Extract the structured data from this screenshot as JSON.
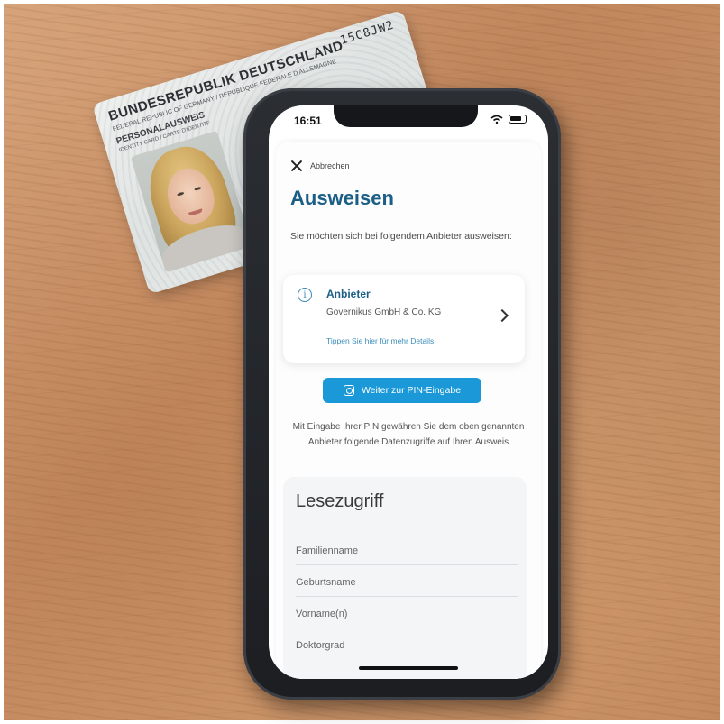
{
  "id_card": {
    "title": "BUNDESREPUBLIK DEUTSCHLAND",
    "subtitle": "FEDERAL REPUBLIC OF GERMANY / REPUBLIQUE FEDERALE D'ALLEMAGNE",
    "doc_type": "PERSONALAUSWEIS",
    "doc_type_sub": "IDENTITY CARD / CARTE D'IDENTITE",
    "number": "15C8JW2"
  },
  "status_bar": {
    "time": "16:51"
  },
  "sheet": {
    "close_label": "Abbrechen",
    "title": "Ausweisen",
    "intro": "Sie möchten sich bei folgendem Anbieter ausweisen:",
    "provider": {
      "label": "Anbieter",
      "name": "Governikus GmbH & Co. KG",
      "details_link": "Tippen Sie hier für mehr Details"
    },
    "pin_button": "Weiter zur PIN-Eingabe",
    "consent": "Mit Eingabe Ihrer PIN gewähren Sie dem oben genannten Anbieter folgende Datenzugriffe auf Ihren Ausweis",
    "read_access": {
      "title": "Lesezugriff",
      "fields": [
        "Familienname",
        "Geburtsname",
        "Vorname(n)",
        "Doktorgrad"
      ]
    }
  }
}
